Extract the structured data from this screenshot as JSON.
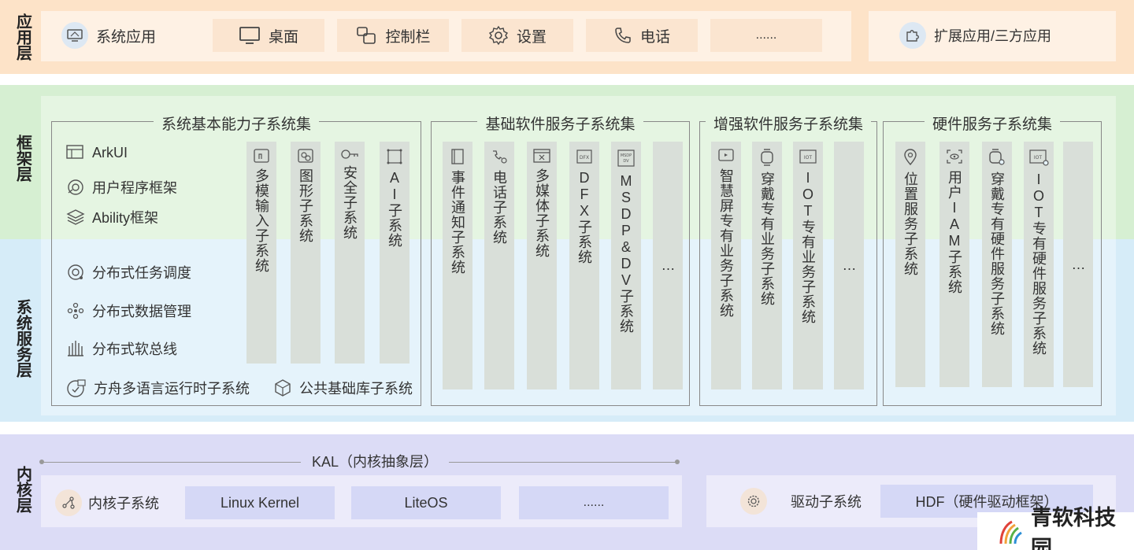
{
  "layers": {
    "app": "应用层",
    "framework": "框架层",
    "system": "系统服务层",
    "kernel": "内核层"
  },
  "app_layer": {
    "items": [
      {
        "label": "系统应用",
        "icon": "system-app-icon"
      },
      {
        "label": "桌面",
        "icon": "monitor-icon"
      },
      {
        "label": "控制栏",
        "icon": "control-bar-icon"
      },
      {
        "label": "设置",
        "icon": "gear-icon"
      },
      {
        "label": "电话",
        "icon": "phone-icon"
      },
      {
        "label": "......",
        "icon": ""
      }
    ],
    "ext": {
      "label": "扩展应用/三方应用",
      "icon": "puzzle-icon"
    }
  },
  "groups": [
    {
      "title": "系统基本能力子系统集",
      "left_items": [
        {
          "label": "ArkUI",
          "icon": "arkui-icon"
        },
        {
          "label": "用户程序框架",
          "icon": "app-framework-icon"
        },
        {
          "label": "Ability框架",
          "icon": "layers-icon"
        },
        {
          "label": "分布式任务调度",
          "icon": "task-schedule-icon"
        },
        {
          "label": "分布式数据管理",
          "icon": "data-manage-icon"
        },
        {
          "label": "分布式软总线",
          "icon": "softbus-icon"
        },
        {
          "label": "方舟多语言运行时子系统",
          "icon": "runtime-icon"
        },
        {
          "label": "公共基础库子系统",
          "icon": "cube-icon"
        }
      ],
      "columns": [
        "多模输入子系统",
        "图形子系统",
        "安全子系统",
        "AI子系统"
      ]
    },
    {
      "title": "基础软件服务子系统集",
      "columns": [
        "事件通知子系统",
        "电话子系统",
        "多媒体子系统",
        "DFX子系统",
        "MSDP&DV子系统",
        "…"
      ]
    },
    {
      "title": "增强软件服务子系统集",
      "columns": [
        "智慧屏专有业务子系统",
        "穿戴专有业务子系统",
        "IOT专有业务子系统",
        "…"
      ]
    },
    {
      "title": "硬件服务子系统集",
      "columns": [
        "位置服务子系统",
        "用户IAM子系统",
        "穿戴专有硬件服务子系统",
        "IOT专有硬件服务子系统",
        "…"
      ]
    }
  ],
  "kernel_layer": {
    "kal": "KAL（内核抽象层）",
    "kernel_subsystem": "内核子系统",
    "kernels": [
      "Linux Kernel",
      "LiteOS",
      "......"
    ],
    "driver_subsystem": "驱动子系统",
    "hdf": "HDF（硬件驱动框架）"
  },
  "watermark": "青软科技园"
}
